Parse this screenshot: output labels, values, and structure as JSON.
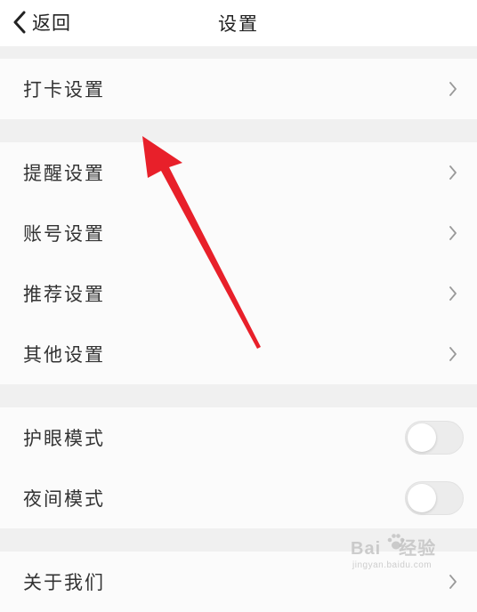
{
  "header": {
    "back_label": "返回",
    "title": "设置"
  },
  "sections": {
    "checkin": {
      "items": [
        {
          "label": "打卡设置",
          "control": "chevron"
        }
      ]
    },
    "general": {
      "items": [
        {
          "label": "提醒设置",
          "control": "chevron"
        },
        {
          "label": "账号设置",
          "control": "chevron"
        },
        {
          "label": "推荐设置",
          "control": "chevron"
        },
        {
          "label": "其他设置",
          "control": "chevron"
        }
      ]
    },
    "display": {
      "items": [
        {
          "label": "护眼模式",
          "control": "toggle",
          "on": false
        },
        {
          "label": "夜间模式",
          "control": "toggle",
          "on": false
        }
      ]
    },
    "about": {
      "items": [
        {
          "label": "关于我们",
          "control": "chevron"
        }
      ]
    }
  },
  "annotation": {
    "arrow_color": "#e8202a",
    "points_to": "打卡设置"
  },
  "watermark": {
    "logo_left": "Bai",
    "logo_right": "经验",
    "url": "jingyan.baidu.com"
  },
  "colors": {
    "background": "#ffffff",
    "section_gap": "#f0f0f0",
    "row_background": "#fbfbfb",
    "text": "#333333",
    "chevron": "#999999",
    "toggle_off": "#ececec"
  }
}
